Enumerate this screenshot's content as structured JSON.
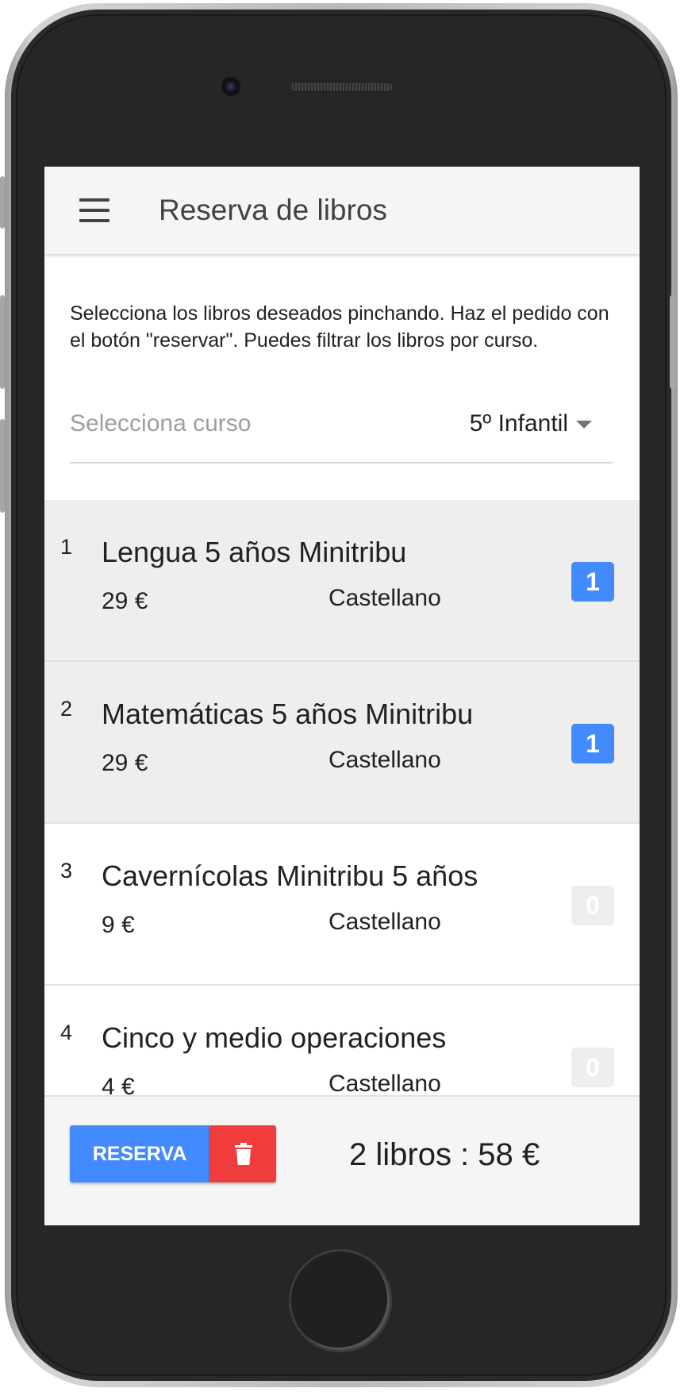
{
  "appbar": {
    "title": "Reserva de libros",
    "menu_icon": "hamburger-menu-icon"
  },
  "intro": "Selecciona los libros deseados pinchando. Haz el pedido con el botón \"reservar\". Puedes filtrar los libros por curso.",
  "course_select": {
    "label": "Selecciona curso",
    "value": "5º Infantil",
    "icon": "dropdown-caret-icon"
  },
  "books": [
    {
      "num": "1",
      "title": "Lengua 5 años Minitribu",
      "price": "29 €",
      "language": "Castellano",
      "qty": "1",
      "selected": true
    },
    {
      "num": "2",
      "title": "Matemáticas 5 años Minitribu",
      "price": "29 €",
      "language": "Castellano",
      "qty": "1",
      "selected": true
    },
    {
      "num": "3",
      "title": "Cavernícolas Minitribu 5 años",
      "price": "9 €",
      "language": "Castellano",
      "qty": "0",
      "selected": false
    },
    {
      "num": "4",
      "title": "Cinco y medio operaciones",
      "price": "4 €",
      "language": "Castellano",
      "qty": "0",
      "selected": false
    }
  ],
  "footer": {
    "reserve_label": "RESERVA",
    "delete_icon": "trash-icon",
    "summary": "2 libros : 58 €"
  },
  "colors": {
    "accent": "#448aff",
    "danger": "#f03c3c",
    "selected_row": "#eeeeee",
    "appbar": "#f5f5f5"
  }
}
